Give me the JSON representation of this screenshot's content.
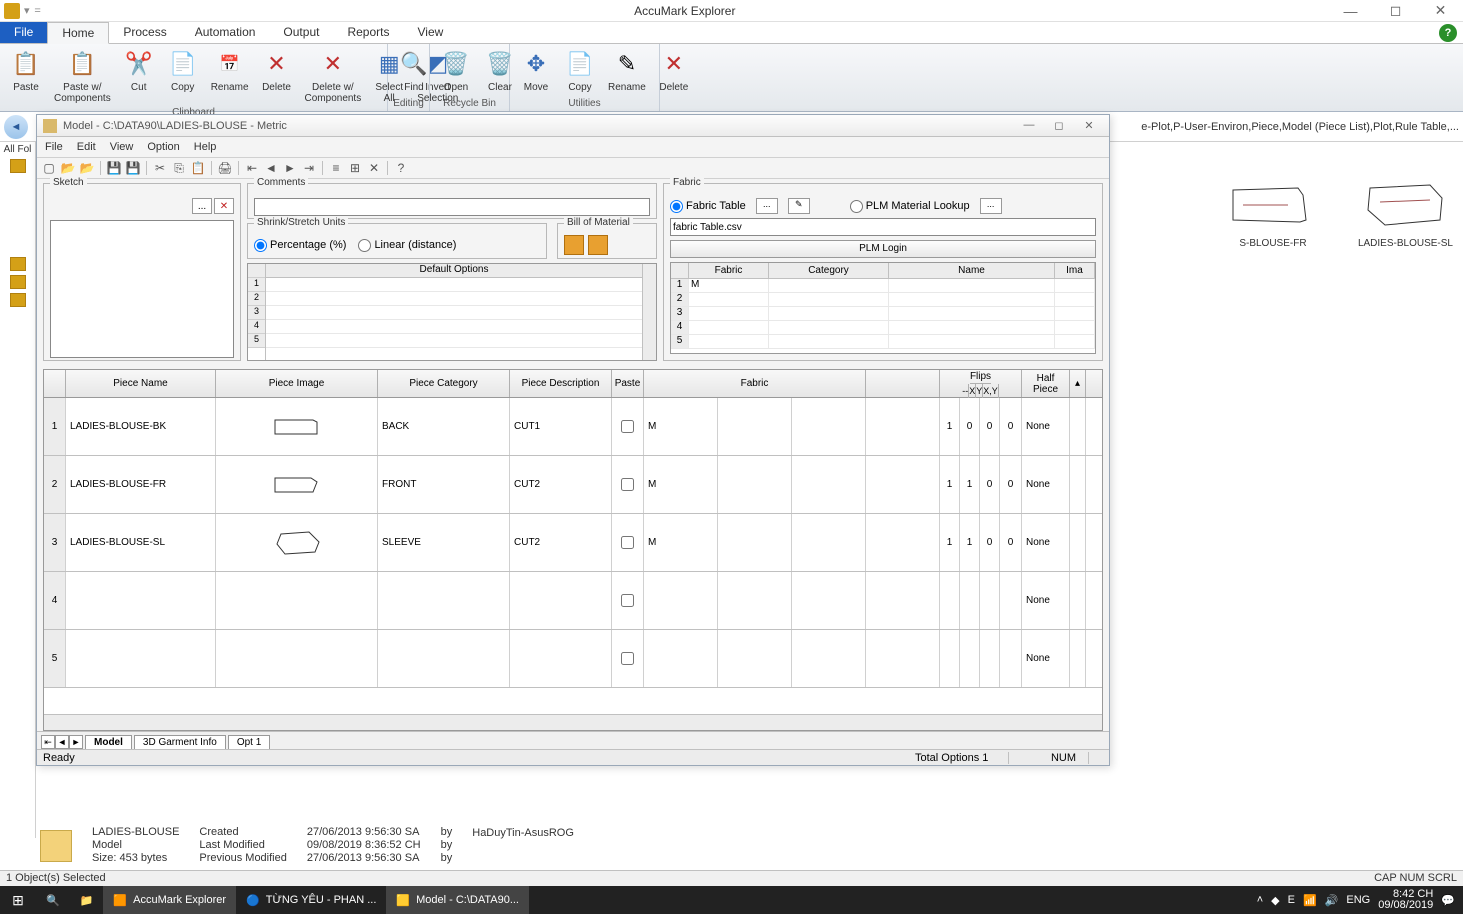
{
  "app": {
    "title": "AccuMark Explorer"
  },
  "tabs": {
    "file": "File",
    "home": "Home",
    "process": "Process",
    "automation": "Automation",
    "output": "Output",
    "reports": "Reports",
    "view": "View"
  },
  "ribbon": {
    "clipboard": {
      "label": "Clipboard",
      "paste": "Paste",
      "pastewc": "Paste w/\nComponents",
      "cut": "Cut",
      "rename": "Rename",
      "delete": "Delete",
      "deletewc": "Delete w/\nComponents",
      "selectall": "Select\nAll",
      "invert": "Invert\nSelection",
      "copy": "Copy"
    },
    "editing": {
      "label": "Editing",
      "find": "Find"
    },
    "recycle": {
      "label": "Recycle Bin",
      "open": "Open",
      "clear": "Clear"
    },
    "utilities": {
      "label": "Utilities",
      "move": "Move",
      "copy": "Copy",
      "rename": "Rename",
      "delete": "Delete"
    }
  },
  "explorer": {
    "allfolders": "All Fol",
    "crumbs_behind": "e-Plot,P-User-Environ,Piece,Model (Piece List),Plot,Rule Table,..."
  },
  "preview": {
    "p1": "S-BLOUSE-FR",
    "p2": "LADIES-BLOUSE-SL"
  },
  "details": {
    "name": "LADIES-BLOUSE",
    "type": "Model",
    "size": "Size: 453 bytes",
    "created_l": "Created",
    "modified_l": "Last Modified",
    "prev_l": "Previous Modified",
    "created": "27/06/2013 9:56:30 SA",
    "modified": "09/08/2019 8:36:52 CH",
    "prev": "27/06/2013 9:56:30 SA",
    "by": "by",
    "by_user": "HaDuyTin-AsusROG"
  },
  "status_exp": {
    "text": "1 Object(s) Selected",
    "caps": "CAP  NUM  SCRL"
  },
  "modelwin": {
    "title": "Model - C:\\DATA90\\LADIES-BLOUSE - Metric",
    "menu": {
      "file": "File",
      "edit": "Edit",
      "view": "View",
      "option": "Option",
      "help": "Help"
    },
    "sketch": "Sketch",
    "comments": "Comments",
    "shrink": {
      "legend": "Shrink/Stretch Units",
      "pct": "Percentage (%)",
      "lin": "Linear (distance)"
    },
    "bom": "Bill of Material",
    "defopts": "Default Options",
    "fabric": {
      "legend": "Fabric",
      "table": "Fabric Table",
      "plm": "PLM Material Lookup",
      "path": "fabric Table.csv",
      "login": "PLM Login",
      "cols": {
        "fabric": "Fabric",
        "category": "Category",
        "name": "Name",
        "image": "Ima"
      },
      "r1_fabric": "M"
    },
    "ptcols": {
      "name": "Piece Name",
      "image": "Piece Image",
      "category": "Piece Category",
      "desc": "Piece Description",
      "paste": "Paste",
      "fabric": "Fabric",
      "flips": "Flips",
      "half": "Half\nPiece",
      "x": "X",
      "y": "Y",
      "xy": "X,Y",
      "dash": "--"
    },
    "pieces": [
      {
        "n": "1",
        "name": "LADIES-BLOUSE-BK",
        "cat": "BACK",
        "desc": "CUT1",
        "fabric": "M",
        "qty": "1",
        "fx": "0",
        "fy": "0",
        "fxy": "0",
        "half": "None"
      },
      {
        "n": "2",
        "name": "LADIES-BLOUSE-FR",
        "cat": "FRONT",
        "desc": "CUT2",
        "fabric": "M",
        "qty": "1",
        "fx": "1",
        "fy": "0",
        "fxy": "0",
        "half": "None"
      },
      {
        "n": "3",
        "name": "LADIES-BLOUSE-SL",
        "cat": "SLEEVE",
        "desc": "CUT2",
        "fabric": "M",
        "qty": "1",
        "fx": "1",
        "fy": "0",
        "fxy": "0",
        "half": "None"
      },
      {
        "n": "4",
        "name": "",
        "cat": "",
        "desc": "",
        "fabric": "",
        "qty": "",
        "fx": "",
        "fy": "",
        "fxy": "",
        "half": "None"
      },
      {
        "n": "5",
        "name": "",
        "cat": "",
        "desc": "",
        "fabric": "",
        "qty": "",
        "fx": "",
        "fy": "",
        "fxy": "",
        "half": "None"
      }
    ],
    "btabs": {
      "model": "Model",
      "gi": "3D Garment Info",
      "opt": "Opt 1"
    },
    "status": {
      "ready": "Ready",
      "total": "Total Options 1",
      "num": "NUM"
    }
  },
  "taskbar": {
    "t1": "AccuMark Explorer",
    "t2": "TỪNG YÊU - PHAN ...",
    "t3": "Model - C:\\DATA90...",
    "lang": "ENG",
    "time": "8:42 CH",
    "date": "09/08/2019"
  }
}
